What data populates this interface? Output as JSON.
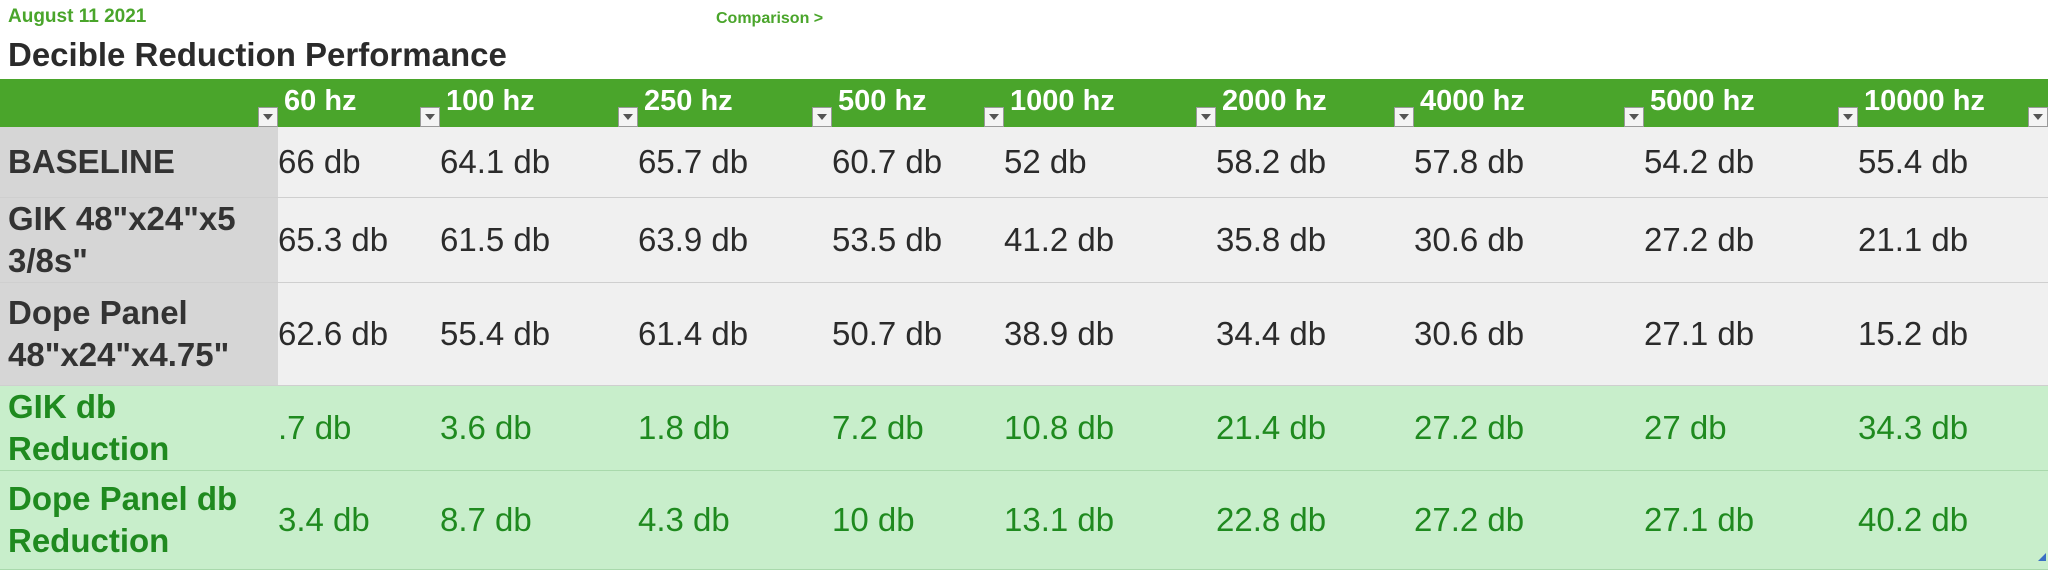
{
  "header": {
    "date": "August 11 2021",
    "comparison_link": "Comparison >",
    "title": "Decible Reduction Performance"
  },
  "table": {
    "columns": [
      "60 hz",
      "100 hz",
      "250 hz",
      "500 hz",
      "1000 hz",
      "2000 hz",
      "4000 hz",
      "5000 hz",
      "10000 hz"
    ],
    "rows": [
      {
        "label": "BASELINE",
        "style": "gray",
        "values": [
          "66 db",
          "64.1 db",
          "65.7 db",
          "60.7 db",
          "52 db",
          "58.2 db",
          "57.8 db",
          "54.2 db",
          "55.4 db"
        ]
      },
      {
        "label": "GIK 48\"x24\"x5 3/8s\"",
        "style": "gray",
        "values": [
          "65.3 db",
          "61.5 db",
          "63.9 db",
          "53.5 db",
          "41.2 db",
          "35.8 db",
          "30.6 db",
          "27.2 db",
          "21.1 db"
        ]
      },
      {
        "label": "Dope Panel 48\"x24\"x4.75\"",
        "style": "gray",
        "values": [
          "62.6 db",
          "55.4 db",
          "61.4 db",
          "50.7 db",
          "38.9 db",
          "34.4 db",
          "30.6 db",
          "27.1 db",
          "15.2 db"
        ]
      },
      {
        "label": "GIK db Reduction",
        "style": "green",
        "values": [
          ".7 db",
          "3.6 db",
          "1.8 db",
          "7.2 db",
          "10.8 db",
          "21.4 db",
          "27.2 db",
          "27 db",
          "34.3 db"
        ]
      },
      {
        "label": "Dope Panel db Reduction",
        "style": "green",
        "values": [
          "3.4 db",
          "8.7 db",
          "4.3 db",
          "10 db",
          "13.1 db",
          "22.8 db",
          "27.2 db",
          "27.1 db",
          "40.2 db"
        ]
      }
    ]
  },
  "colors": {
    "accent_green": "#4aa52b",
    "reduction_row_bg": "#c8eecb",
    "reduction_text": "#1f8a1f",
    "baseline_row_bg": "#f0f0f0"
  },
  "icons": {
    "filter": "filter-dropdown-icon",
    "resize": "resize-handle-icon"
  }
}
